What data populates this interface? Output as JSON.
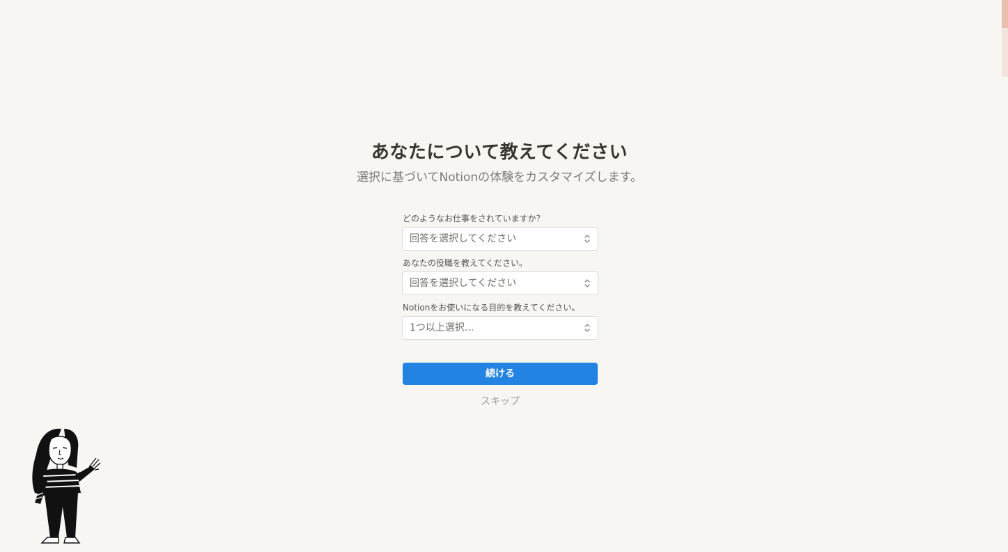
{
  "header": {
    "title": "あなたについて教えてください",
    "subtitle": "選択に基づいてNotionの体験をカスタマイズします。"
  },
  "form": {
    "fields": [
      {
        "label": "どのようなお仕事をされていますか？",
        "value": "回答を選択してください"
      },
      {
        "label": "あなたの役職を教えてください。",
        "value": "回答を選択してください"
      },
      {
        "label": "Notionをお使いになる目的を教えてください。",
        "value": "1つ以上選択..."
      }
    ],
    "continue_label": "続ける",
    "skip_label": "スキップ"
  },
  "colors": {
    "background": "#f7f6f3",
    "accent": "#2383e2"
  },
  "icons": {
    "select_chevron": "chevron-up-down-icon",
    "illustration": "person-waving-illustration"
  }
}
